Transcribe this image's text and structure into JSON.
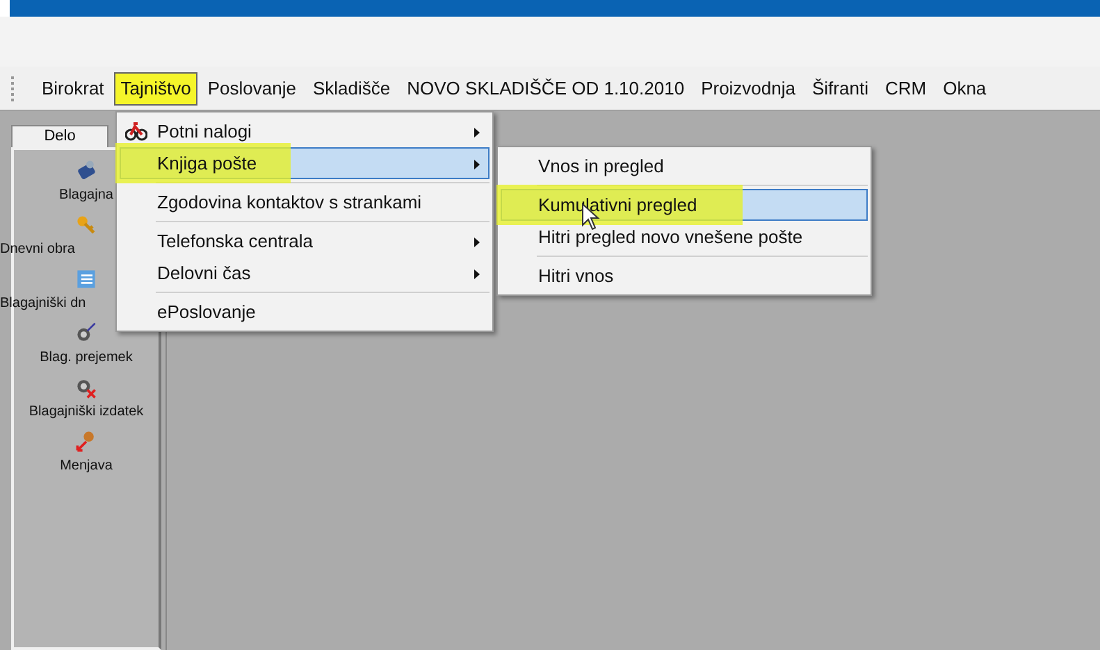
{
  "menubar": [
    {
      "label": "Birokrat",
      "selected": false,
      "marked": false
    },
    {
      "label": "Tajništvo",
      "selected": true,
      "marked": true
    },
    {
      "label": "Poslovanje",
      "selected": false,
      "marked": false
    },
    {
      "label": "Skladišče",
      "selected": false,
      "marked": false
    },
    {
      "label": "NOVO SKLADIŠČE OD 1.10.2010",
      "selected": false,
      "marked": false
    },
    {
      "label": "Proizvodnja",
      "selected": false,
      "marked": false
    },
    {
      "label": "Šifranti",
      "selected": false,
      "marked": false
    },
    {
      "label": "CRM",
      "selected": false,
      "marked": false
    },
    {
      "label": "Okna",
      "selected": false,
      "marked": false
    }
  ],
  "side_panel": {
    "tab": "Delo",
    "items": [
      {
        "label": "Blagajna",
        "kind": "full"
      },
      {
        "label": "Dnevni obra",
        "kind": "cut"
      },
      {
        "label": "Blagajniški dn",
        "kind": "cut"
      },
      {
        "label": "Blag. prejemek",
        "kind": "full"
      },
      {
        "label": "Blagajniški izdatek",
        "kind": "full"
      },
      {
        "label": "Menjava",
        "kind": "full"
      }
    ]
  },
  "menu": [
    {
      "kind": "item",
      "label": "Potni nalogi",
      "submenu": true,
      "selected": false,
      "marked": false
    },
    {
      "kind": "item",
      "label": "Knjiga pošte",
      "submenu": true,
      "selected": true,
      "marked": true
    },
    {
      "kind": "separator"
    },
    {
      "kind": "item",
      "label": "Zgodovina kontaktov s strankami",
      "submenu": false,
      "selected": false,
      "marked": false
    },
    {
      "kind": "separator"
    },
    {
      "kind": "item",
      "label": "Telefonska centrala",
      "submenu": true,
      "selected": false,
      "marked": false
    },
    {
      "kind": "item",
      "label": "Delovni čas",
      "submenu": true,
      "selected": false,
      "marked": false
    },
    {
      "kind": "separator"
    },
    {
      "kind": "item",
      "label": "ePoslovanje",
      "submenu": false,
      "selected": false,
      "marked": false
    }
  ],
  "submenu": [
    {
      "kind": "item",
      "label": "Vnos in pregled",
      "selected": false,
      "marked": false
    },
    {
      "kind": "separator"
    },
    {
      "kind": "item",
      "label": "Kumulativni pregled",
      "selected": true,
      "marked": true
    },
    {
      "kind": "item",
      "label": "Hitri pregled novo vnešene pošte",
      "selected": false,
      "marked": false
    },
    {
      "kind": "separator"
    },
    {
      "kind": "item",
      "label": "Hitri vnos",
      "selected": false,
      "marked": false
    }
  ]
}
